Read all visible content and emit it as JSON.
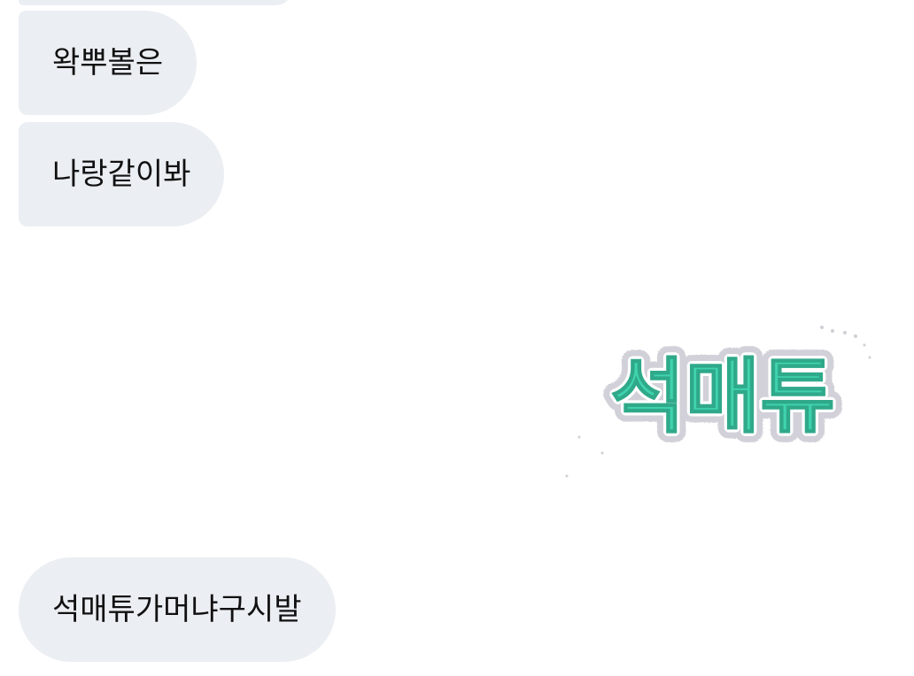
{
  "messages": [
    {
      "text": "왁뿌볼은"
    },
    {
      "text": "나랑같이봐"
    },
    {
      "text": "석매튜가머냐구시발"
    }
  ],
  "sticker": {
    "text": "석매튜",
    "fill_color": "#3fd3ae",
    "outline_color": "#d9d7de"
  },
  "colors": {
    "bubble_bg": "#ebeef2",
    "text": "#111111",
    "background": "#ffffff"
  }
}
